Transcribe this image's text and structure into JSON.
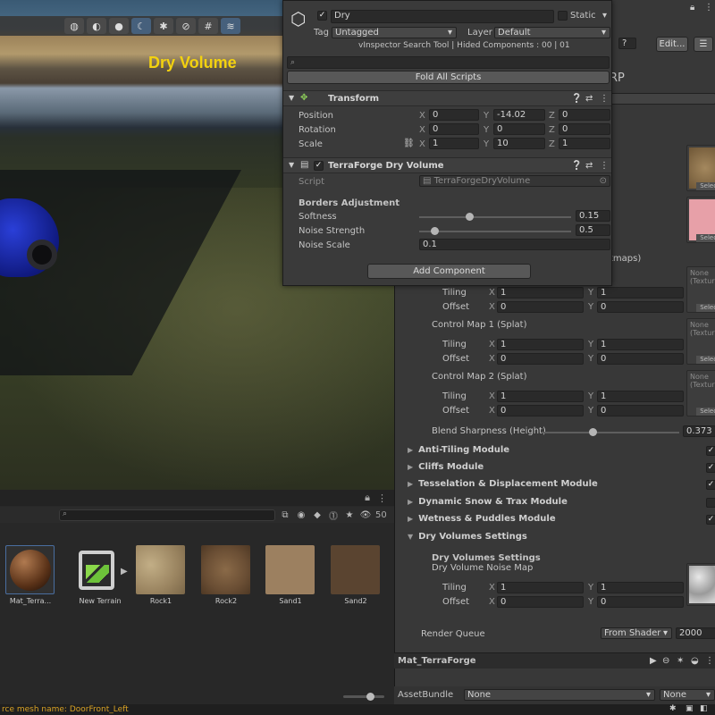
{
  "scene": {
    "label": "Dry Volume",
    "toolbar_icons": [
      "globe-icon",
      "palette-icon",
      "sphere-icon",
      "moon-icon",
      "bug-icon",
      "eye-slash-icon",
      "grid-icon",
      "layers-icon"
    ]
  },
  "popup": {
    "object_name": "Dry",
    "static_label": "Static",
    "tag_label": "Tag",
    "tag_value": "Untagged",
    "layer_label": "Layer",
    "layer_value": "Default",
    "vinspector_info": "vInspector Search Tool | Hided Components : 00 | 01",
    "fold_all": "Fold All Scripts",
    "transform": {
      "title": "Transform",
      "rows": [
        {
          "label": "Position",
          "x": "0",
          "y": "-14.02",
          "z": "0"
        },
        {
          "label": "Rotation",
          "x": "0",
          "y": "0",
          "z": "0"
        },
        {
          "label": "Scale",
          "x": "1",
          "y": "10",
          "z": "1"
        }
      ]
    },
    "dry_volume": {
      "title": "TerraForge Dry Volume",
      "script_label": "Script",
      "script_value": "TerraForgeDryVolume",
      "section": "Borders Adjustment",
      "softness_label": "Softness",
      "softness_value": "0.15",
      "softness_fraction": 0.15,
      "noise_strength_label": "Noise Strength",
      "noise_strength_value": "0.5",
      "noise_strength_fraction": 0.1,
      "noise_scale_label": "Noise Scale",
      "noise_scale_value": "0.1"
    },
    "add_component": "Add Component"
  },
  "inspector": {
    "edit_button": "Edit...",
    "rp_text": "RP",
    "maps_text": "tmaps)",
    "texture_none": "None (Texture",
    "select": "Select",
    "control_maps": [
      {
        "title": "",
        "tiling_label": "Tiling",
        "offset_label": "Offset",
        "tiling_x": "1",
        "tiling_y": "1",
        "offset_x": "0",
        "offset_y": "0"
      },
      {
        "title": "Control Map 1 (Splat)",
        "tiling_label": "Tiling",
        "offset_label": "Offset",
        "tiling_x": "1",
        "tiling_y": "1",
        "offset_x": "0",
        "offset_y": "0"
      },
      {
        "title": "Control Map 2 (Splat)",
        "tiling_label": "Tiling",
        "offset_label": "Offset",
        "tiling_x": "1",
        "tiling_y": "1",
        "offset_x": "0",
        "offset_y": "0"
      }
    ],
    "blend_label": "Blend Sharpness (Height)",
    "blend_value": "0.373",
    "blend_fraction": 0.373,
    "modules": [
      {
        "label": "Anti-Tiling Module",
        "checked": true
      },
      {
        "label": "Cliffs Module",
        "checked": true
      },
      {
        "label": "Tesselation & Displacement Module",
        "checked": true
      },
      {
        "label": "Dynamic Snow & Trax Module",
        "checked": false
      },
      {
        "label": "Wetness & Puddles Module",
        "checked": true
      }
    ],
    "dry_settings_fold": "Dry Volumes Settings",
    "dry_settings_title": "Dry Volumes Settings",
    "dry_noise_map": "Dry Volume Noise Map",
    "dry_tiling_label": "Tiling",
    "dry_offset_label": "Offset",
    "dry_tiling_x": "1",
    "dry_tiling_y": "1",
    "dry_offset_x": "0",
    "dry_offset_y": "0",
    "render_queue_label": "Render Queue",
    "render_queue_mode": "From Shader",
    "render_queue_value": "2000",
    "material_name": "Mat_TerraForge",
    "assetbundle_label": "AssetBundle",
    "assetbundle_value": "None",
    "assetbundle_variant": "None"
  },
  "project": {
    "zoom_value": "50",
    "assets": [
      {
        "label": "Mat_Terra...",
        "kind": "material"
      },
      {
        "label": "New Terrain",
        "kind": "terrain"
      },
      {
        "label": "Rock1",
        "kind": "texture"
      },
      {
        "label": "Rock2",
        "kind": "texture"
      },
      {
        "label": "Sand1",
        "kind": "texture"
      },
      {
        "label": "Sand2",
        "kind": "texture"
      }
    ],
    "status_text": "rce mesh name: DoorFront_Left"
  },
  "colors": {
    "scene_label": "#f3d20f",
    "accent_blue": "#46607c",
    "status_warning": "#d9a224"
  }
}
